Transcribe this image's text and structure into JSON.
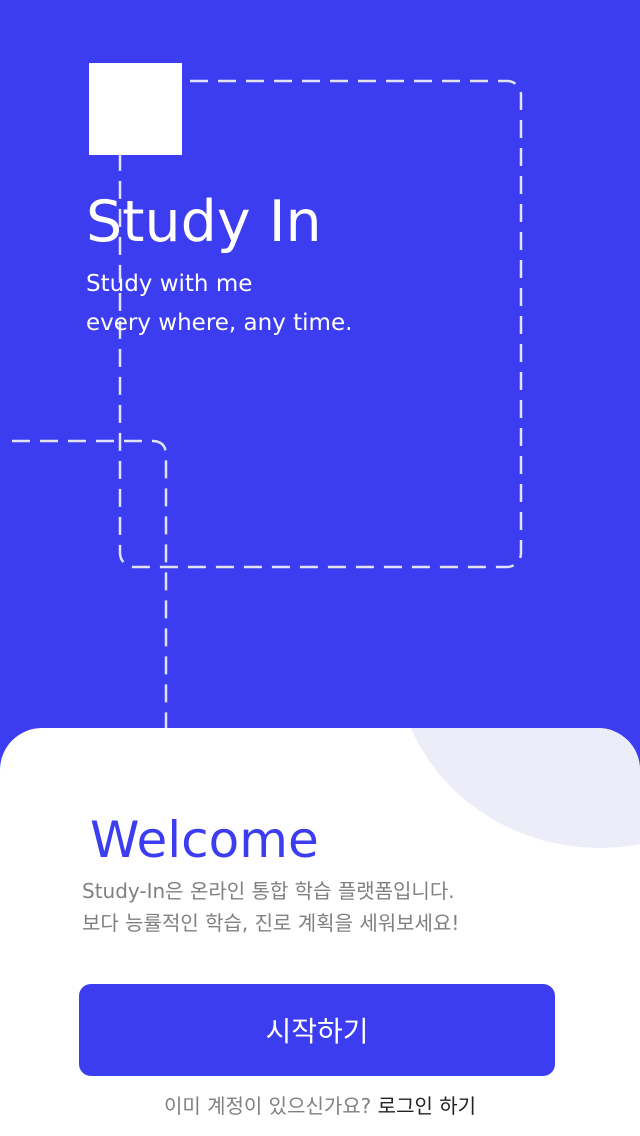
{
  "hero": {
    "title": "Study In",
    "tagline_line1": "Study with me",
    "tagline_line2": "every where, any time."
  },
  "welcome": {
    "title": "Welcome",
    "description_line1": "Study-In은 온라인 통합 학습 플랫폼입니다.",
    "description_line2": "보다 능률적인 학습, 진로 계획을 세워보세요!"
  },
  "actions": {
    "start_label": "시작하기",
    "login_prompt": "이미 계정이 있으신가요?",
    "login_link": "로그인 하기"
  },
  "colors": {
    "primary": "#3c3cf0",
    "sheet_background": "#ffffff",
    "sheet_accent": "#ededfa",
    "muted_text": "#808080"
  }
}
